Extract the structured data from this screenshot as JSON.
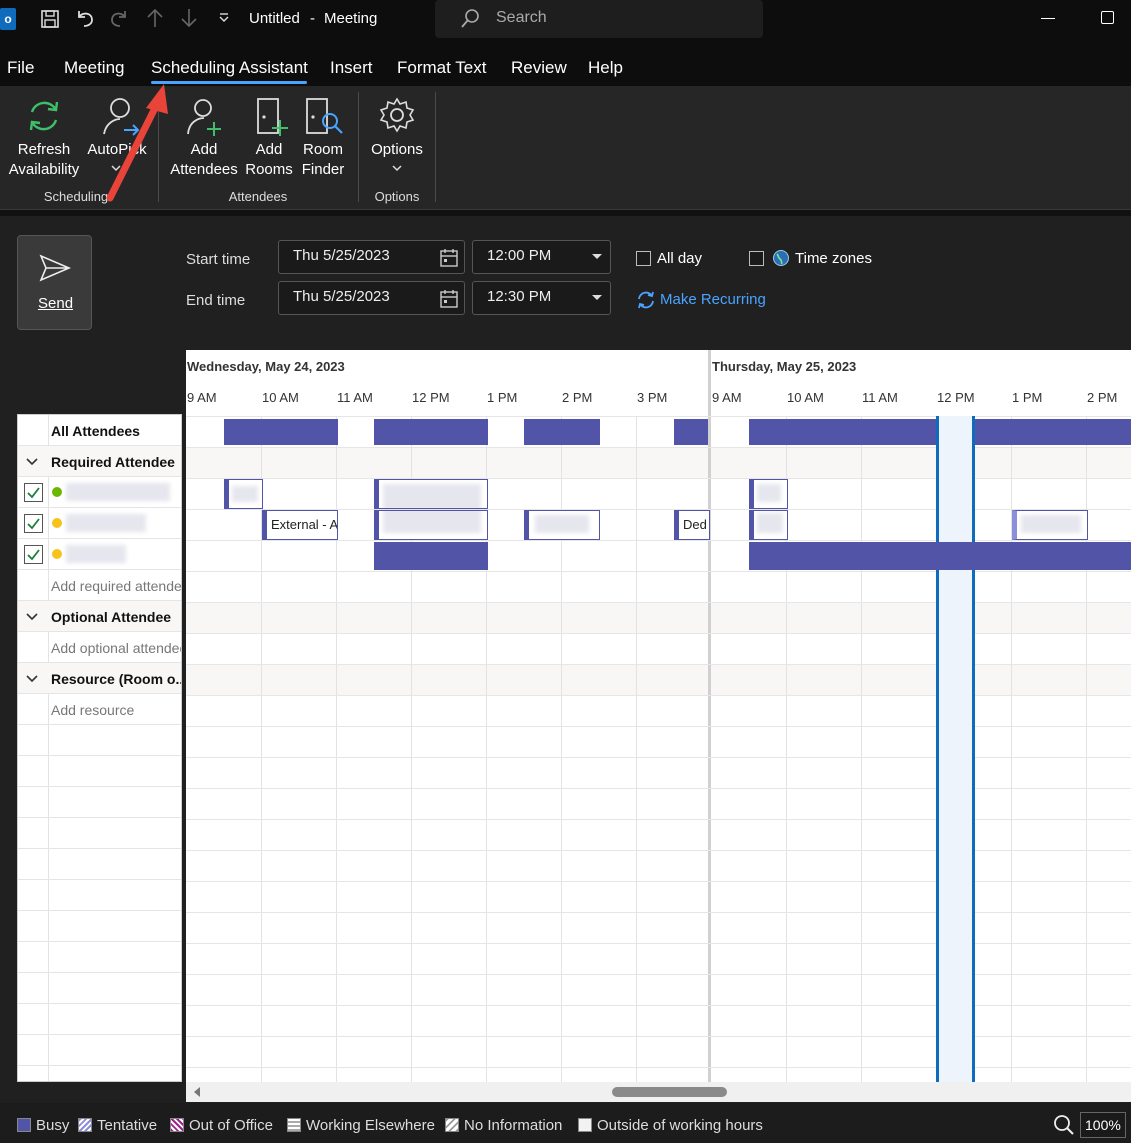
{
  "titlebar": {
    "title": "Untitled",
    "separator": "-",
    "subtitle": "Meeting",
    "search_placeholder": "Search",
    "icons": [
      "outlook-icon",
      "save-icon",
      "undo-icon",
      "redo-icon",
      "up-arrow-icon",
      "down-arrow-icon",
      "customize-icon",
      "search-icon",
      "minimize-icon",
      "maximize-icon"
    ]
  },
  "menu": {
    "tabs": [
      {
        "label": "File"
      },
      {
        "label": "Meeting"
      },
      {
        "label": "Scheduling Assistant",
        "active": true
      },
      {
        "label": "Insert"
      },
      {
        "label": "Format Text"
      },
      {
        "label": "Review"
      },
      {
        "label": "Help"
      }
    ]
  },
  "ribbon": {
    "refresh": "Refresh",
    "refresh2": "Availability",
    "autopick": "AutoPick",
    "add_attendees": "Add",
    "add_attendees2": "Attendees",
    "add_rooms": "Add",
    "add_rooms2": "Rooms",
    "room_finder": "Room",
    "room_finder2": "Finder",
    "options": "Options",
    "group_scheduling": "Scheduling",
    "group_attendees": "Attendees",
    "group_options": "Options"
  },
  "form": {
    "send": "Send",
    "start_label": "Start time",
    "end_label": "End time",
    "start_date": "Thu 5/25/2023",
    "start_time": "12:00 PM",
    "end_date": "Thu 5/25/2023",
    "end_time": "12:30 PM",
    "all_day": "All day",
    "time_zones": "Time zones",
    "make_recurring": "Make Recurring"
  },
  "grid": {
    "day1": "Wednesday, May 24, 2023",
    "day2": "Thursday, May 25, 2023",
    "times1": [
      "9 AM",
      "10 AM",
      "11 AM",
      "12 PM",
      "1 PM",
      "2 PM",
      "3 PM"
    ],
    "times2": [
      "9 AM",
      "10 AM",
      "11 AM",
      "12 PM",
      "1 PM",
      "2 PM"
    ],
    "evt_external": "External - A",
    "evt_ded": "Ded"
  },
  "attendees": {
    "all": "All Attendees",
    "required": "Required Attendee",
    "add_required": "Add required attendee",
    "optional": "Optional Attendee",
    "add_optional": "Add optional attendee",
    "resource": "Resource (Room o...",
    "add_resource": "Add resource"
  },
  "legend": {
    "busy": "Busy",
    "tentative": "Tentative",
    "ooo": "Out of Office",
    "elsewhere": "Working Elsewhere",
    "noinfo": "No Information",
    "outside": "Outside of working hours",
    "zoom": "100%"
  },
  "colors": {
    "busy": "#5254a8",
    "accent": "#0f6cbd",
    "link": "#4aa3ff"
  }
}
